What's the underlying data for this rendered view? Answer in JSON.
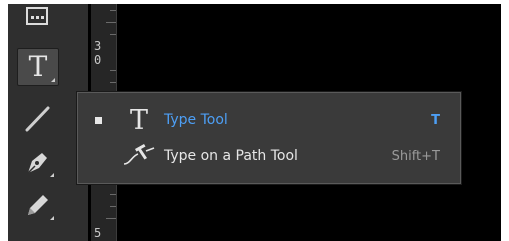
{
  "toolbar": {
    "tools": [
      {
        "name": "frame-grid-tool",
        "icon": "grid-frame-icon"
      },
      {
        "name": "type-tool",
        "glyph": "T",
        "icon": "type-icon",
        "selected": true
      },
      {
        "name": "line-tool",
        "icon": "line-icon"
      },
      {
        "name": "pen-tool",
        "icon": "pen-icon"
      },
      {
        "name": "pencil-tool",
        "icon": "pencil-icon"
      }
    ]
  },
  "ruler": {
    "labels": [
      "3",
      "0",
      "5"
    ]
  },
  "flyout": {
    "items": [
      {
        "label": "Type Tool",
        "shortcut": "T",
        "icon": "type-icon",
        "glyph": "T",
        "active": true
      },
      {
        "label": "Type on a Path Tool",
        "shortcut": "Shift+T",
        "icon": "type-on-path-icon",
        "active": false
      }
    ]
  },
  "colors": {
    "accent": "#4d9ff5",
    "panel": "#2f2f2f",
    "flyout": "#3a3a3a",
    "canvas": "#000000"
  }
}
